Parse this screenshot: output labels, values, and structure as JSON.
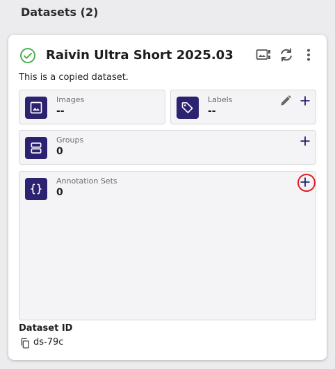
{
  "page": {
    "title": "Datasets (2)"
  },
  "dataset": {
    "name": "Raivin Ultra Short 2025.03",
    "description": "This is a copied dataset.",
    "status_icon": "check-circle-icon",
    "status_color": "#4caf50",
    "header_actions": [
      "gallery-icon",
      "refresh-icon",
      "more-vert-icon"
    ]
  },
  "tiles": {
    "images": {
      "label": "Images",
      "value": "--",
      "icon": "image-icon"
    },
    "labels": {
      "label": "Labels",
      "value": "--",
      "icon": "tag-icon"
    },
    "groups": {
      "label": "Groups",
      "value": "0",
      "icon": "groups-icon"
    },
    "annotation_sets": {
      "label": "Annotation Sets",
      "value": "0",
      "icon": "braces-icon"
    }
  },
  "dataset_id": {
    "label": "Dataset ID",
    "value": "ds-79c",
    "icon": "copy-icon"
  },
  "colors": {
    "badge": "#2b2270",
    "action_icon": "#2b2270",
    "highlight": "#e31e24"
  }
}
